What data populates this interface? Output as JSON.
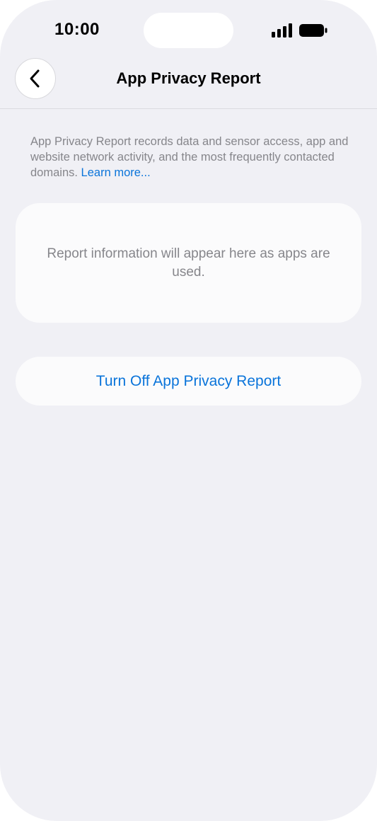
{
  "status_bar": {
    "time": "10:00",
    "signal_icon": "cellular-signal-icon",
    "battery_icon": "battery-full-icon"
  },
  "nav": {
    "back_icon": "chevron-left-icon",
    "title": "App Privacy Report"
  },
  "description": {
    "text": "App Privacy Report records data and sensor access, app and website network activity, and the most frequently contacted domains. ",
    "link": "Learn more..."
  },
  "report_card": {
    "message": "Report information will appear here as apps are used."
  },
  "actions": {
    "turn_off_label": "Turn Off App Privacy Report"
  },
  "colors": {
    "background": "#f0f0f5",
    "card": "#fbfbfc",
    "accent": "#0a74da",
    "secondary_text": "#86868b"
  }
}
